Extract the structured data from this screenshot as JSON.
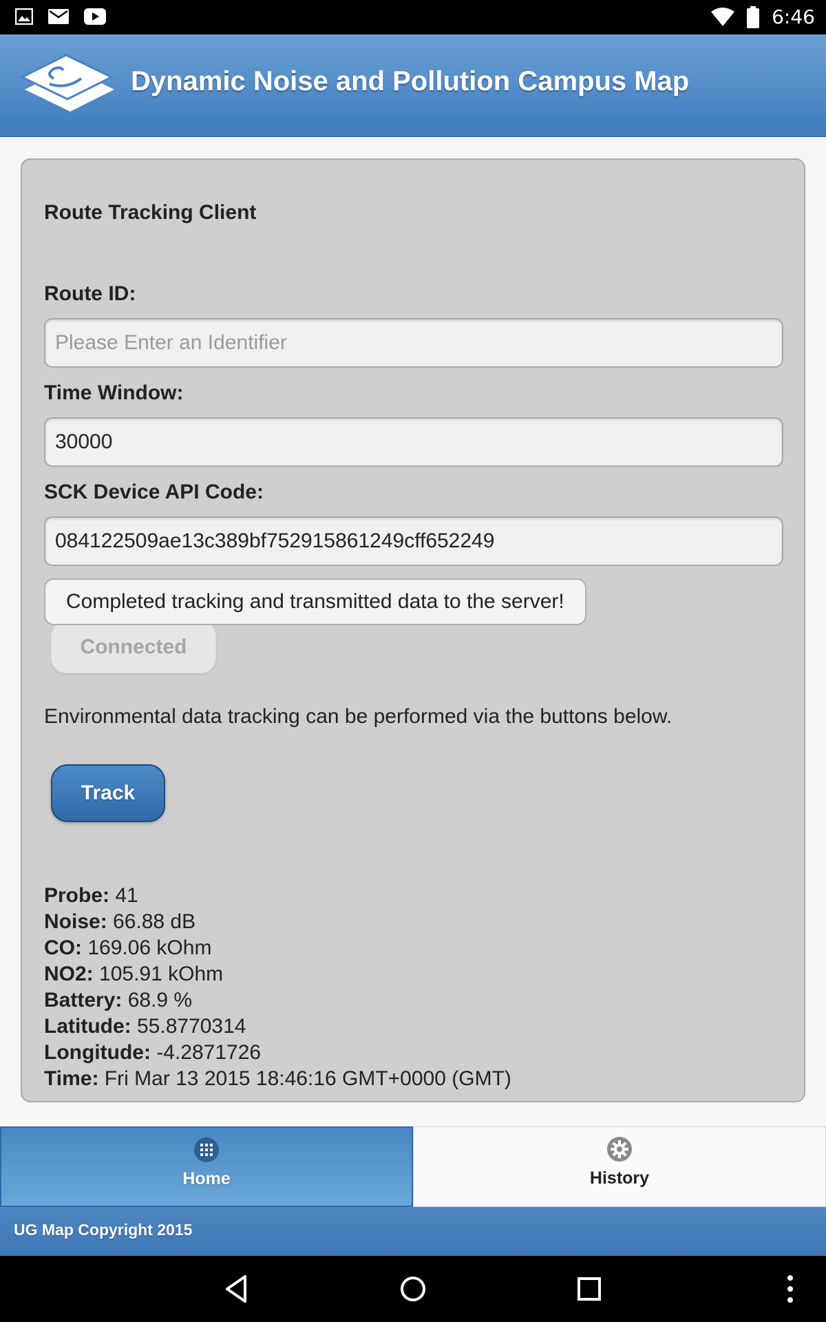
{
  "status_bar": {
    "time": "6:46",
    "left_icons": [
      "image-icon",
      "mail-icon",
      "youtube-icon"
    ],
    "right_icons": [
      "wifi-icon",
      "battery-icon"
    ]
  },
  "header": {
    "title": "Dynamic Noise and Pollution Campus Map",
    "logo": "campus-map-logo"
  },
  "form": {
    "title": "Route Tracking Client",
    "route_id_label": "Route ID:",
    "route_id_value": "",
    "route_id_placeholder": "Please Enter an Identifier",
    "time_window_label": "Time Window:",
    "time_window_value": "30000",
    "api_code_label": "SCK Device API Code:",
    "api_code_value": "084122509ae13c389bf752915861249cff652249",
    "status_message": "Completed tracking and transmitted data to the server!",
    "connected_label": "Connected",
    "info_text": "Environmental data tracking can be performed via the buttons below.",
    "track_label": "Track"
  },
  "readings": [
    {
      "label": "Probe:",
      "value": " 41"
    },
    {
      "label": "Noise:",
      "value": " 66.88 dB"
    },
    {
      "label": "CO:",
      "value": " 169.06 kOhm"
    },
    {
      "label": "NO2:",
      "value": " 105.91 kOhm"
    },
    {
      "label": "Battery:",
      "value": " 68.9 %"
    },
    {
      "label": "Latitude:",
      "value": " 55.8770314"
    },
    {
      "label": "Longitude:",
      "value": " -4.2871726"
    },
    {
      "label": "Time:",
      "value": " Fri Mar 13 2015 18:46:16 GMT+0000 (GMT)"
    }
  ],
  "tabs": [
    {
      "label": "Home",
      "icon": "grid-icon",
      "active": true
    },
    {
      "label": "History",
      "icon": "gear-icon",
      "active": false
    }
  ],
  "footer": {
    "text": "UG Map Copyright 2015"
  },
  "colors": {
    "header_blue": "#4f88c6",
    "card_gray": "#cfcfcf",
    "track_button": "#3a74b3"
  }
}
